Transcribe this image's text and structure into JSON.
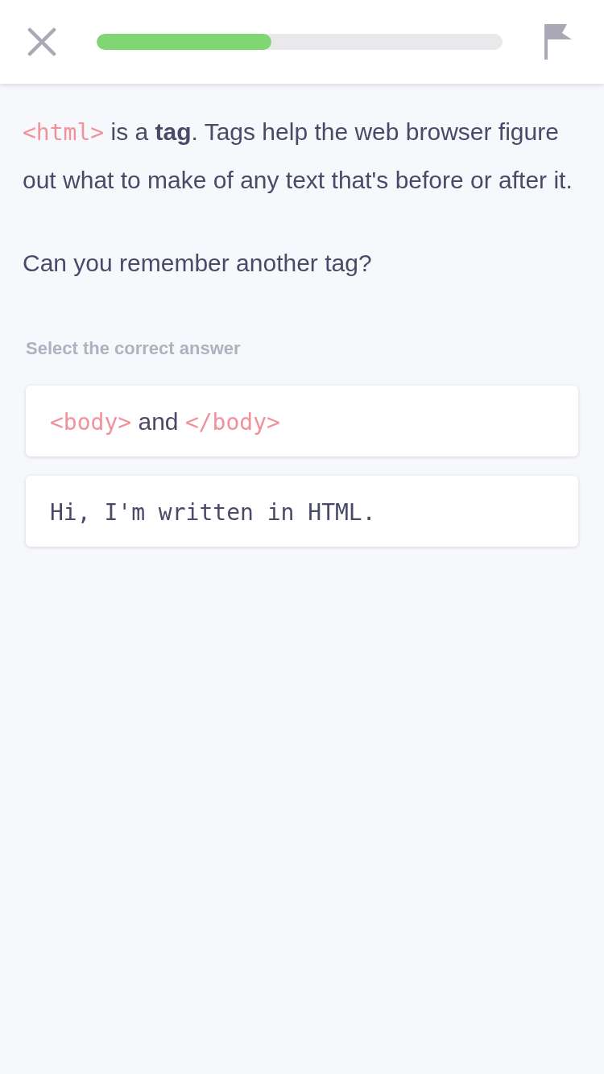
{
  "header": {
    "progress": {
      "level": 0.43
    }
  },
  "intro": [
    {
      "kind": "code",
      "text": "<html>"
    },
    {
      "kind": "text",
      "text": " is a **tag**. Tags help the web browser figure out what to make of any text that's before or after it."
    }
  ],
  "question": "Can you remember another tag?",
  "instruction": "Select the correct answer",
  "options": [
    {
      "selected": false,
      "segments": [
        {
          "kind": "code",
          "text": "<body>"
        },
        {
          "kind": "text",
          "text": " and "
        },
        {
          "kind": "code",
          "text": "</body>"
        }
      ]
    },
    {
      "selected": false,
      "segments": [
        {
          "kind": "mono",
          "text": "Hi, I'm written in HTML."
        }
      ]
    }
  ]
}
